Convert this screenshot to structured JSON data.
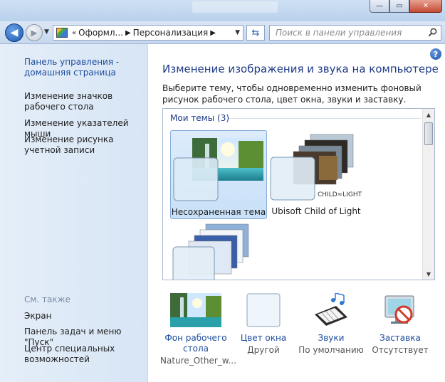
{
  "window": {
    "minimize_glyph": "—",
    "maximize_glyph": "▭",
    "close_glyph": "✕"
  },
  "navbar": {
    "back_glyph": "◀",
    "forward_glyph": "▶",
    "address_prefix": "«",
    "breadcrumbs": [
      "Оформл...",
      "Персонализация"
    ],
    "search_placeholder": "Поиск в панели управления"
  },
  "sidebar": {
    "home_link": "Панель управления - домашняя страница",
    "links": [
      "Изменение значков рабочего стола",
      "Изменение указателей мыши",
      "Изменение рисунка учетной записи"
    ],
    "see_also_label": "См. также",
    "see_also": [
      "Экран",
      "Панель задач и меню \"Пуск\"",
      "Центр специальных возможностей"
    ]
  },
  "main": {
    "help_glyph": "?",
    "title": "Изменение изображения и звука на компьютере",
    "description": "Выберите тему, чтобы одновременно изменить фоновый рисунок рабочего стола, цвет окна, звуки и заставку.",
    "group_title": "Мои темы (3)",
    "themes": [
      {
        "label": "Несохраненная тема",
        "selected": true
      },
      {
        "label": "Ubisoft Child of Light",
        "selected": false,
        "brand_text": "CHILD≈LIGHT"
      },
      {
        "label": "",
        "selected": false
      }
    ]
  },
  "settings": [
    {
      "name": "Фон рабочего стола",
      "value": "Nature_Other_w..."
    },
    {
      "name": "Цвет окна",
      "value": "Другой"
    },
    {
      "name": "Звуки",
      "value": "По умолчанию"
    },
    {
      "name": "Заставка",
      "value": "Отсутствует"
    }
  ],
  "colors": {
    "link": "#1a4b9c",
    "title": "#1e3a87",
    "sidebar_bg": "#dde9f7",
    "selection_bg": "#cfe3f9"
  }
}
